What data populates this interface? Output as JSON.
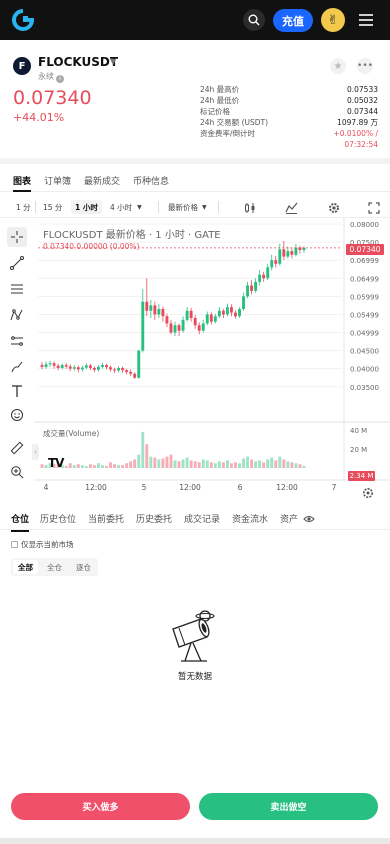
{
  "topbar": {
    "deposit_label": "充值",
    "avatar_glyph": "✌"
  },
  "market": {
    "symbol": "FLOCKUSDT",
    "coin_glyph": "F",
    "type": "永续",
    "info_glyph": "i",
    "price": "0.07340",
    "change": "+44.01%",
    "stats": [
      {
        "label": "24h 最高价",
        "value": "0.07533"
      },
      {
        "label": "24h 最低价",
        "value": "0.05032"
      },
      {
        "label": "标记价格",
        "value": "0.07344"
      },
      {
        "label": "24h 交易额 (USDT)",
        "value": "1097.89 万"
      }
    ],
    "funding_label": "资金费率/倒计时",
    "funding_rate": "+0.0100% /",
    "funding_countdown": "07:32:54"
  },
  "tabs": [
    "图表",
    "订单簿",
    "最新成交",
    "币种信息"
  ],
  "toolbar": {
    "intervals": [
      "1 分",
      "15 分",
      "1 小时",
      "4 小时"
    ],
    "price_type": "最新价格"
  },
  "chart": {
    "title": "FLOCKUSDT 最新价格 · 1 小时 · GATE",
    "ohlc": "0.07340  0.00000 (0.00%)",
    "vol_title": "成交量(Volume)",
    "price_tag": "0.07340",
    "vol_tag": "2.34 M",
    "tv_logo": "TV"
  },
  "chart_data": {
    "type": "candlestick",
    "title": "FLOCKUSDT 最新价格 · 1 小时 · GATE",
    "price_axis_ticks": [
      "0.08000",
      "0.07500",
      "0.06999",
      "0.06499",
      "0.05999",
      "0.05499",
      "0.04999",
      "0.04500",
      "0.04000",
      "0.03500"
    ],
    "volume_axis_ticks": [
      "40 M",
      "20 M"
    ],
    "x_ticks": [
      "4",
      "12:00",
      "5",
      "12:00",
      "6",
      "12:00",
      "7"
    ],
    "last_price": 0.0734,
    "last_volume": "2.34 M",
    "ylim": [
      0.033,
      0.08
    ],
    "volume_label": "成交量(Volume)",
    "candles": [
      {
        "o": 0.041,
        "c": 0.0405,
        "h": 0.0418,
        "l": 0.0398,
        "v": 4
      },
      {
        "o": 0.0405,
        "c": 0.0412,
        "h": 0.042,
        "l": 0.04,
        "v": 3
      },
      {
        "o": 0.0412,
        "c": 0.0415,
        "h": 0.0422,
        "l": 0.0405,
        "v": 5
      },
      {
        "o": 0.0415,
        "c": 0.0408,
        "h": 0.042,
        "l": 0.04,
        "v": 4
      },
      {
        "o": 0.0408,
        "c": 0.0402,
        "h": 0.0414,
        "l": 0.0396,
        "v": 6
      },
      {
        "o": 0.0402,
        "c": 0.041,
        "h": 0.0415,
        "l": 0.0398,
        "v": 3
      },
      {
        "o": 0.041,
        "c": 0.0406,
        "h": 0.0416,
        "l": 0.04,
        "v": 2
      },
      {
        "o": 0.0406,
        "c": 0.04,
        "h": 0.0412,
        "l": 0.0393,
        "v": 5
      },
      {
        "o": 0.04,
        "c": 0.0404,
        "h": 0.041,
        "l": 0.0395,
        "v": 3
      },
      {
        "o": 0.0404,
        "c": 0.0398,
        "h": 0.0409,
        "l": 0.039,
        "v": 4
      },
      {
        "o": 0.0398,
        "c": 0.0403,
        "h": 0.0408,
        "l": 0.0392,
        "v": 3
      },
      {
        "o": 0.0403,
        "c": 0.0409,
        "h": 0.0415,
        "l": 0.0398,
        "v": 2
      },
      {
        "o": 0.0409,
        "c": 0.0402,
        "h": 0.0413,
        "l": 0.0396,
        "v": 4
      },
      {
        "o": 0.0402,
        "c": 0.0397,
        "h": 0.0406,
        "l": 0.039,
        "v": 3
      },
      {
        "o": 0.0397,
        "c": 0.0405,
        "h": 0.041,
        "l": 0.0392,
        "v": 5
      },
      {
        "o": 0.0405,
        "c": 0.041,
        "h": 0.0416,
        "l": 0.04,
        "v": 3
      },
      {
        "o": 0.041,
        "c": 0.0404,
        "h": 0.0414,
        "l": 0.0398,
        "v": 2
      },
      {
        "o": 0.0404,
        "c": 0.0398,
        "h": 0.0409,
        "l": 0.0392,
        "v": 6
      },
      {
        "o": 0.0398,
        "c": 0.0395,
        "h": 0.0403,
        "l": 0.0388,
        "v": 4
      },
      {
        "o": 0.0395,
        "c": 0.0402,
        "h": 0.0407,
        "l": 0.039,
        "v": 3
      },
      {
        "o": 0.0402,
        "c": 0.0396,
        "h": 0.0406,
        "l": 0.0388,
        "v": 3
      },
      {
        "o": 0.0396,
        "c": 0.0391,
        "h": 0.04,
        "l": 0.0384,
        "v": 5
      },
      {
        "o": 0.0391,
        "c": 0.0386,
        "h": 0.0398,
        "l": 0.038,
        "v": 7
      },
      {
        "o": 0.0386,
        "c": 0.0375,
        "h": 0.039,
        "l": 0.0372,
        "v": 9
      },
      {
        "o": 0.0375,
        "c": 0.045,
        "h": 0.0452,
        "l": 0.0372,
        "v": 14
      },
      {
        "o": 0.045,
        "c": 0.0585,
        "h": 0.062,
        "l": 0.0445,
        "v": 38
      },
      {
        "o": 0.0585,
        "c": 0.056,
        "h": 0.065,
        "l": 0.0545,
        "v": 25
      },
      {
        "o": 0.056,
        "c": 0.0575,
        "h": 0.059,
        "l": 0.054,
        "v": 12
      },
      {
        "o": 0.0575,
        "c": 0.055,
        "h": 0.0585,
        "l": 0.0535,
        "v": 11
      },
      {
        "o": 0.055,
        "c": 0.0565,
        "h": 0.0578,
        "l": 0.054,
        "v": 9
      },
      {
        "o": 0.0565,
        "c": 0.0545,
        "h": 0.0572,
        "l": 0.053,
        "v": 10
      },
      {
        "o": 0.0545,
        "c": 0.0525,
        "h": 0.0552,
        "l": 0.0515,
        "v": 12
      },
      {
        "o": 0.0525,
        "c": 0.05,
        "h": 0.0535,
        "l": 0.0495,
        "v": 14
      },
      {
        "o": 0.05,
        "c": 0.052,
        "h": 0.053,
        "l": 0.049,
        "v": 8
      },
      {
        "o": 0.052,
        "c": 0.0505,
        "h": 0.0525,
        "l": 0.049,
        "v": 7
      },
      {
        "o": 0.0505,
        "c": 0.0535,
        "h": 0.0545,
        "l": 0.05,
        "v": 9
      },
      {
        "o": 0.0535,
        "c": 0.056,
        "h": 0.057,
        "l": 0.053,
        "v": 11
      },
      {
        "o": 0.056,
        "c": 0.054,
        "h": 0.0568,
        "l": 0.053,
        "v": 8
      },
      {
        "o": 0.054,
        "c": 0.052,
        "h": 0.0548,
        "l": 0.051,
        "v": 7
      },
      {
        "o": 0.052,
        "c": 0.0505,
        "h": 0.0528,
        "l": 0.0495,
        "v": 6
      },
      {
        "o": 0.0505,
        "c": 0.0525,
        "h": 0.0535,
        "l": 0.05,
        "v": 9
      },
      {
        "o": 0.0525,
        "c": 0.055,
        "h": 0.0558,
        "l": 0.052,
        "v": 8
      },
      {
        "o": 0.055,
        "c": 0.053,
        "h": 0.0556,
        "l": 0.0522,
        "v": 6
      },
      {
        "o": 0.053,
        "c": 0.0545,
        "h": 0.0552,
        "l": 0.0525,
        "v": 5
      },
      {
        "o": 0.0545,
        "c": 0.056,
        "h": 0.057,
        "l": 0.054,
        "v": 7
      },
      {
        "o": 0.056,
        "c": 0.055,
        "h": 0.0565,
        "l": 0.054,
        "v": 6
      },
      {
        "o": 0.055,
        "c": 0.057,
        "h": 0.058,
        "l": 0.0545,
        "v": 8
      },
      {
        "o": 0.057,
        "c": 0.0555,
        "h": 0.0578,
        "l": 0.0545,
        "v": 5
      },
      {
        "o": 0.0555,
        "c": 0.0545,
        "h": 0.0562,
        "l": 0.0538,
        "v": 6
      },
      {
        "o": 0.0545,
        "c": 0.0565,
        "h": 0.057,
        "l": 0.054,
        "v": 5
      },
      {
        "o": 0.0565,
        "c": 0.06,
        "h": 0.061,
        "l": 0.056,
        "v": 10
      },
      {
        "o": 0.06,
        "c": 0.063,
        "h": 0.064,
        "l": 0.0595,
        "v": 12
      },
      {
        "o": 0.063,
        "c": 0.0615,
        "h": 0.0645,
        "l": 0.0605,
        "v": 9
      },
      {
        "o": 0.0615,
        "c": 0.064,
        "h": 0.065,
        "l": 0.061,
        "v": 7
      },
      {
        "o": 0.064,
        "c": 0.066,
        "h": 0.0672,
        "l": 0.063,
        "v": 8
      },
      {
        "o": 0.066,
        "c": 0.065,
        "h": 0.0668,
        "l": 0.064,
        "v": 6
      },
      {
        "o": 0.065,
        "c": 0.068,
        "h": 0.069,
        "l": 0.0645,
        "v": 9
      },
      {
        "o": 0.068,
        "c": 0.07,
        "h": 0.0715,
        "l": 0.0672,
        "v": 11
      },
      {
        "o": 0.07,
        "c": 0.069,
        "h": 0.0712,
        "l": 0.068,
        "v": 8
      },
      {
        "o": 0.069,
        "c": 0.073,
        "h": 0.0745,
        "l": 0.0685,
        "v": 12
      },
      {
        "o": 0.073,
        "c": 0.071,
        "h": 0.0753,
        "l": 0.07,
        "v": 9
      },
      {
        "o": 0.071,
        "c": 0.0725,
        "h": 0.0738,
        "l": 0.0705,
        "v": 7
      },
      {
        "o": 0.0725,
        "c": 0.0715,
        "h": 0.0735,
        "l": 0.0705,
        "v": 6
      },
      {
        "o": 0.0715,
        "c": 0.0735,
        "h": 0.0745,
        "l": 0.071,
        "v": 5
      },
      {
        "o": 0.0735,
        "c": 0.0728,
        "h": 0.074,
        "l": 0.0718,
        "v": 4
      },
      {
        "o": 0.0728,
        "c": 0.0734,
        "h": 0.0738,
        "l": 0.072,
        "v": 2.34
      }
    ]
  },
  "position_tabs": [
    "仓位",
    "历史仓位",
    "当前委托",
    "历史委托",
    "成交记录",
    "资金流水",
    "资产"
  ],
  "filter": {
    "current_only": "仅显示当前市场",
    "options": [
      "全部",
      "全仓",
      "逐仓"
    ]
  },
  "empty": {
    "text": "暂无数据"
  },
  "actions": {
    "buy": "买入做多",
    "sell": "卖出做空"
  },
  "colors": {
    "up": "#27c082",
    "down": "#e84c5c",
    "accent": "#1b66ff"
  }
}
